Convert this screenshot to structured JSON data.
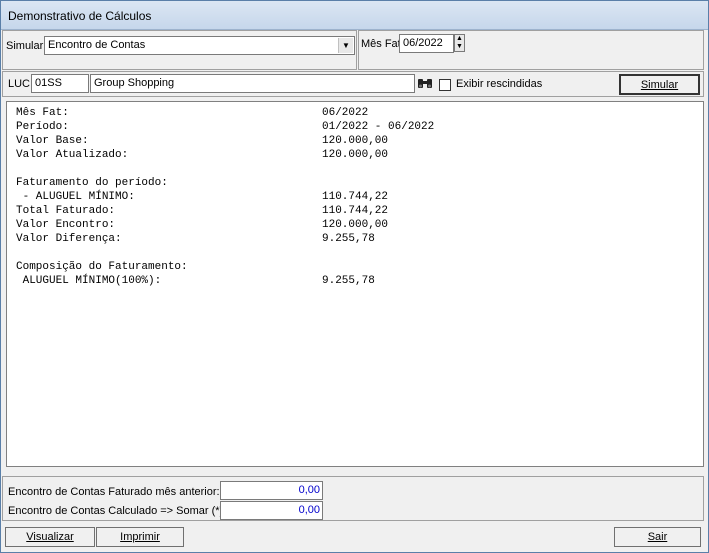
{
  "window": {
    "title": "Demonstrativo de Cálculos"
  },
  "simular": {
    "label": "Simular",
    "value": "Encontro de Contas"
  },
  "mes_fat": {
    "label": "Mês Fat",
    "value": "06/2022"
  },
  "luc": {
    "label": "LUC",
    "code": "01SS",
    "name": "Group Shopping"
  },
  "exibir_rescindidas": {
    "label": "Exibir rescindidas",
    "checked": false
  },
  "simular_button": "Simular",
  "report": {
    "lines": [
      {
        "label": "Mês Fat:",
        "value": "06/2022"
      },
      {
        "label": "Período:",
        "value": "01/2022 - 06/2022"
      },
      {
        "label": "Valor Base:",
        "value": "120.000,00"
      },
      {
        "label": "Valor Atualizado:",
        "value": "120.000,00"
      },
      {
        "label": "",
        "value": ""
      },
      {
        "label": "Faturamento do período:",
        "value": ""
      },
      {
        "label": " - ALUGUEL MÍNIMO:",
        "value": "110.744,22"
      },
      {
        "label": "Total Faturado:",
        "value": "110.744,22"
      },
      {
        "label": "Valor Encontro:",
        "value": "120.000,00"
      },
      {
        "label": "Valor Diferença:",
        "value": "9.255,78"
      },
      {
        "label": "",
        "value": ""
      },
      {
        "label": "Composição do Faturamento:",
        "value": ""
      },
      {
        "label": " ALUGUEL MÍNIMO(100%):",
        "value": "9.255,78"
      }
    ]
  },
  "footer": {
    "faturado_label": "Encontro de Contas Faturado mês anterior:",
    "faturado_value": "0,00",
    "calculado_label": "Encontro de Contas Calculado => Somar (*)",
    "calculado_value": "0,00"
  },
  "buttons": {
    "visualizar": "Visualizar",
    "imprimir": "Imprimir",
    "sair": "Sair"
  }
}
